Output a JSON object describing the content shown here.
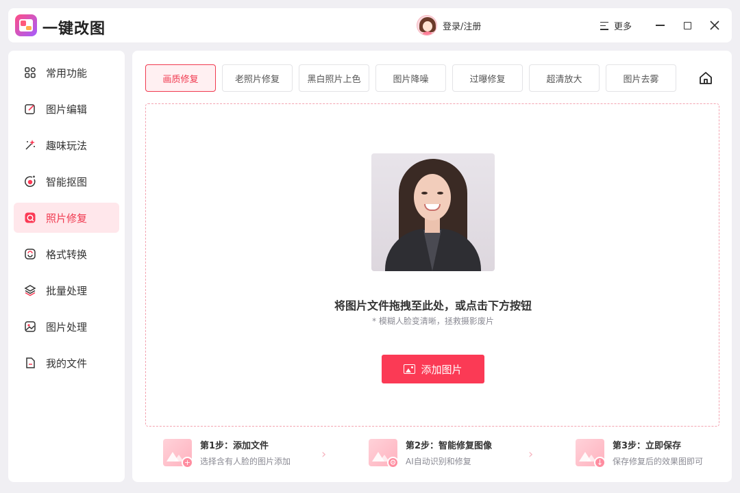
{
  "app": {
    "title": "一键改图"
  },
  "header": {
    "login_label": "登录/注册",
    "more_label": "更多"
  },
  "sidebar": {
    "items": [
      {
        "label": "常用功能",
        "icon": "grid-icon"
      },
      {
        "label": "图片编辑",
        "icon": "edit-icon"
      },
      {
        "label": "趣味玩法",
        "icon": "magic-wand-icon"
      },
      {
        "label": "智能抠图",
        "icon": "target-icon"
      },
      {
        "label": "照片修复",
        "icon": "repair-icon",
        "active": true
      },
      {
        "label": "格式转换",
        "icon": "convert-icon"
      },
      {
        "label": "批量处理",
        "icon": "layers-icon"
      },
      {
        "label": "图片处理",
        "icon": "image-icon"
      },
      {
        "label": "我的文件",
        "icon": "file-icon"
      }
    ]
  },
  "tabs": [
    {
      "label": "画质修复",
      "active": true
    },
    {
      "label": "老照片修复"
    },
    {
      "label": "黑白照片上色"
    },
    {
      "label": "图片降噪"
    },
    {
      "label": "过曝修复"
    },
    {
      "label": "超清放大"
    },
    {
      "label": "图片去雾"
    }
  ],
  "dropzone": {
    "title": "将图片文件拖拽至此处，或点击下方按钮",
    "subtitle": "* 模糊人脸变清晰，拯救摄影废片",
    "button_label": "添加图片"
  },
  "steps": [
    {
      "title": "第1步：添加文件",
      "desc": "选择含有人脸的图片添加",
      "badge": "+"
    },
    {
      "title": "第2步：智能修复图像",
      "desc": "AI自动识别和修复",
      "badge": "⚙"
    },
    {
      "title": "第3步：立即保存",
      "desc": "保存修复后的效果图即可",
      "badge": "↓"
    }
  ],
  "colors": {
    "accent": "#fb3a55",
    "active_bg": "#ffe7eb",
    "dash": "#f3a3b0"
  }
}
